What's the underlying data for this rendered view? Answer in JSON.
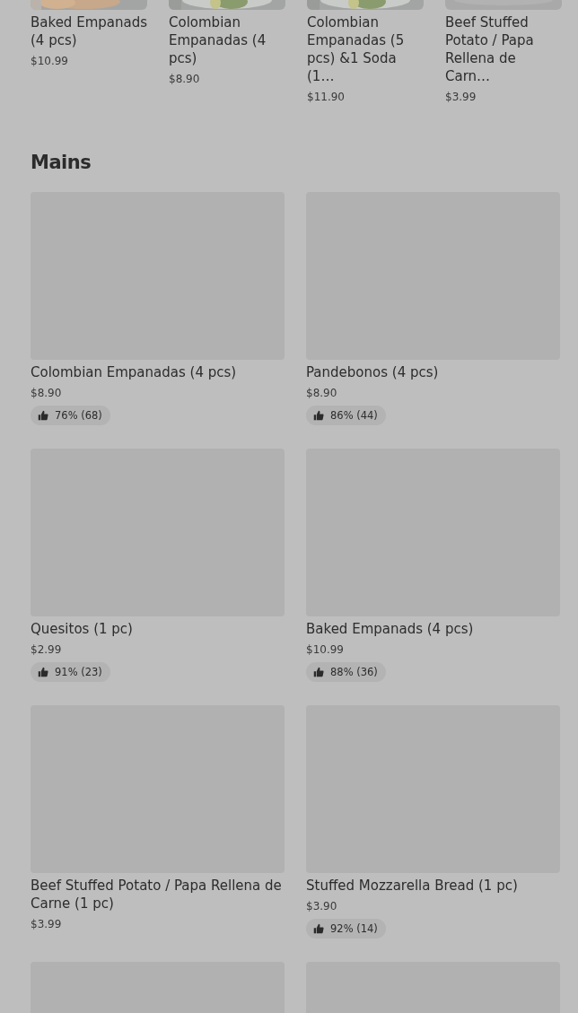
{
  "carousel": [
    {
      "name": "Baked Empanads (4 pcs)",
      "price": "$10.99"
    },
    {
      "name": "Colombian Empanadas (4 pcs)",
      "price": "$8.90"
    },
    {
      "name": "Colombian Empanadas (5 pcs) &1 Soda (1…",
      "price": "$11.90"
    },
    {
      "name": "Beef Stuffed Potato / Papa Rellena de Carn…",
      "price": "$3.99"
    }
  ],
  "section": {
    "heading": "Mains",
    "items": [
      {
        "kind": "item",
        "name": "Colombian Empanadas (4 pcs)",
        "price": "$8.90",
        "rating": "76% (68)"
      },
      {
        "kind": "item",
        "name": "Pandebonos (4 pcs)",
        "price": "$8.90",
        "rating": "86% (44)"
      },
      {
        "kind": "item",
        "name": "Quesitos (1 pc)",
        "price": "$2.99",
        "rating": "91% (23)"
      },
      {
        "kind": "item",
        "name": "Baked Empanads (4 pcs)",
        "price": "$10.99",
        "rating": "88% (36)"
      },
      {
        "kind": "item",
        "name": "Beef Stuffed Potato / Papa Rellena de Carne (1 pc)",
        "price": "$3.99"
      },
      {
        "kind": "item",
        "name": "Stuffed Mozzarella Bread (1 pc)",
        "price": "$3.90",
        "rating": "92% (14)"
      },
      {
        "kind": "image-only"
      },
      {
        "kind": "image-only"
      }
    ]
  }
}
